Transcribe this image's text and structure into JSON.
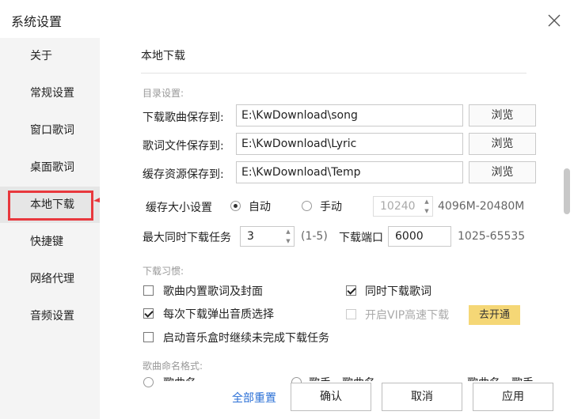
{
  "window": {
    "title": "系统设置"
  },
  "sidebar": {
    "items": [
      {
        "label": "关于"
      },
      {
        "label": "常规设置"
      },
      {
        "label": "窗口歌词"
      },
      {
        "label": "桌面歌词"
      },
      {
        "label": "本地下载"
      },
      {
        "label": "快捷键"
      },
      {
        "label": "网络代理"
      },
      {
        "label": "音频设置"
      }
    ],
    "active_index": 4
  },
  "main": {
    "section_title": "本地下载",
    "directory": {
      "label": "目录设置:",
      "rows": [
        {
          "label": "下载歌曲保存到:",
          "value": "E:\\KwDownload\\song",
          "button": "浏览"
        },
        {
          "label": "歌词文件保存到:",
          "value": "E:\\KwDownload\\Lyric",
          "button": "浏览"
        },
        {
          "label": "缓存资源保存到:",
          "value": "E:\\KwDownload\\Temp",
          "button": "浏览"
        }
      ]
    },
    "cache": {
      "label": "缓存大小设置",
      "auto_label": "自动",
      "manual_label": "手动",
      "selected": "auto",
      "value": "10240",
      "range": "4096M-20480M"
    },
    "tasks": {
      "label": "最大同时下载任务",
      "value": "3",
      "range": "(1-5)",
      "port_label": "下载端口",
      "port_value": "6000",
      "port_range": "1025-65535"
    },
    "habits": {
      "label": "下载习惯:",
      "options": [
        {
          "label": "歌曲内置歌词及封面",
          "checked": false
        },
        {
          "label": "同时下载歌词",
          "checked": true
        },
        {
          "label": "每次下载弹出音质选择",
          "checked": true
        },
        {
          "label": "开启VIP高速下载",
          "checked": false,
          "disabled": true
        },
        {
          "label": "启动音乐盒时继续未完成下载任务",
          "checked": false
        }
      ],
      "vip_button": "去开通"
    },
    "naming": {
      "label": "歌曲命名格式:",
      "options": [
        "歌曲名",
        "歌手 - 歌曲名",
        "歌曲名 - 歌手"
      ]
    }
  },
  "footer": {
    "reset_label": "全部重置",
    "confirm_label": "确认",
    "cancel_label": "取消",
    "apply_label": "应用"
  },
  "colors": {
    "highlight": "#e8383d",
    "link": "#2a6fd6",
    "vip": "#f5d776"
  }
}
